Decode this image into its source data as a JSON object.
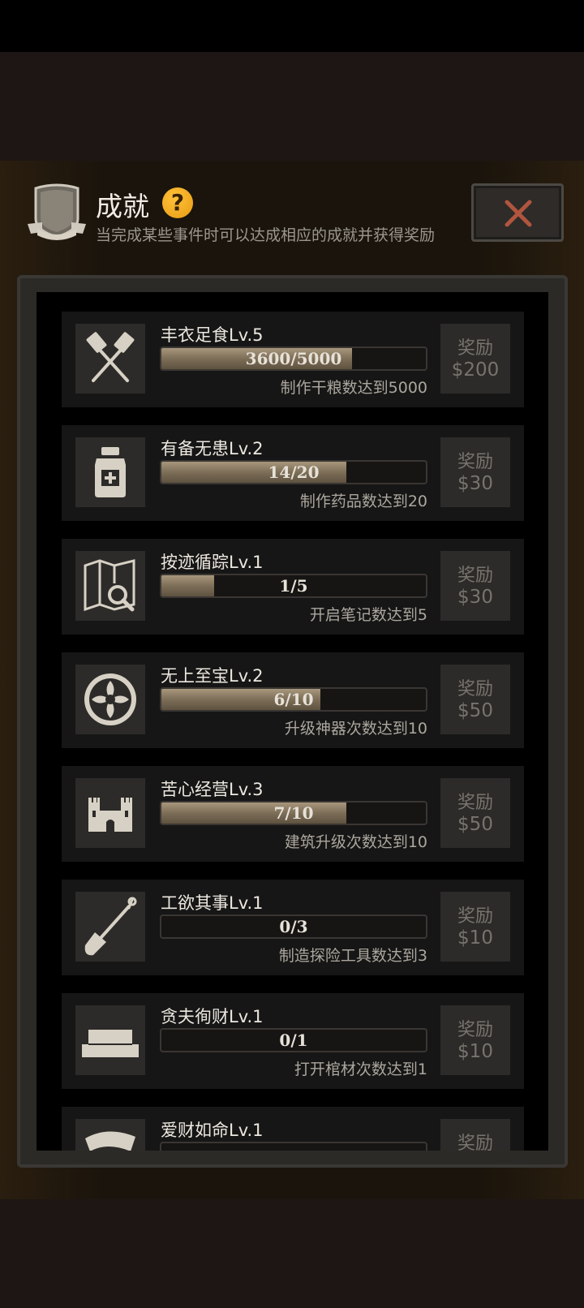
{
  "header": {
    "title": "成就",
    "help_symbol": "?",
    "subtitle": "当完成某些事件时可以达成相应的成就并获得奖励"
  },
  "colors": {
    "help_icon": "#f1a91b",
    "close_x": "#b0553f",
    "progress_fill": "#8c7c63"
  },
  "achievements": [
    {
      "icon": "crossed-spatulas-icon",
      "name": "丰衣足食Lv.5",
      "progress_text": "3600/5000",
      "progress": 0.72,
      "desc": "制作干粮数达到5000",
      "reward_label": "奖励",
      "reward_value": "$200"
    },
    {
      "icon": "medicine-bottle-icon",
      "name": "有备无患Lv.2",
      "progress_text": "14/20",
      "progress": 0.7,
      "desc": "制作药品数达到20",
      "reward_label": "奖励",
      "reward_value": "$30"
    },
    {
      "icon": "map-search-icon",
      "name": "按迹循踪Lv.1",
      "progress_text": "1/5",
      "progress": 0.2,
      "desc": "开启笔记数达到5",
      "reward_label": "奖励",
      "reward_value": "$30"
    },
    {
      "icon": "ornament-medallion-icon",
      "name": "无上至宝Lv.2",
      "progress_text": "6/10",
      "progress": 0.6,
      "desc": "升级神器次数达到10",
      "reward_label": "奖励",
      "reward_value": "$50"
    },
    {
      "icon": "castle-icon",
      "name": "苦心经营Lv.3",
      "progress_text": "7/10",
      "progress": 0.7,
      "desc": "建筑升级次数达到10",
      "reward_label": "奖励",
      "reward_value": "$50"
    },
    {
      "icon": "shovel-icon",
      "name": "工欲其事Lv.1",
      "progress_text": "0/3",
      "progress": 0.0,
      "desc": "制造探险工具数达到3",
      "reward_label": "奖励",
      "reward_value": "$10"
    },
    {
      "icon": "coffin-icon",
      "name": "贪夫徇财Lv.1",
      "progress_text": "0/1",
      "progress": 0.0,
      "desc": "打开棺材次数达到1",
      "reward_label": "奖励",
      "reward_value": "$10"
    },
    {
      "icon": "treasure-icon",
      "name": "爱财如命Lv.1",
      "progress_text": "",
      "progress": 0.0,
      "desc": "",
      "reward_label": "奖励",
      "reward_value": ""
    }
  ]
}
